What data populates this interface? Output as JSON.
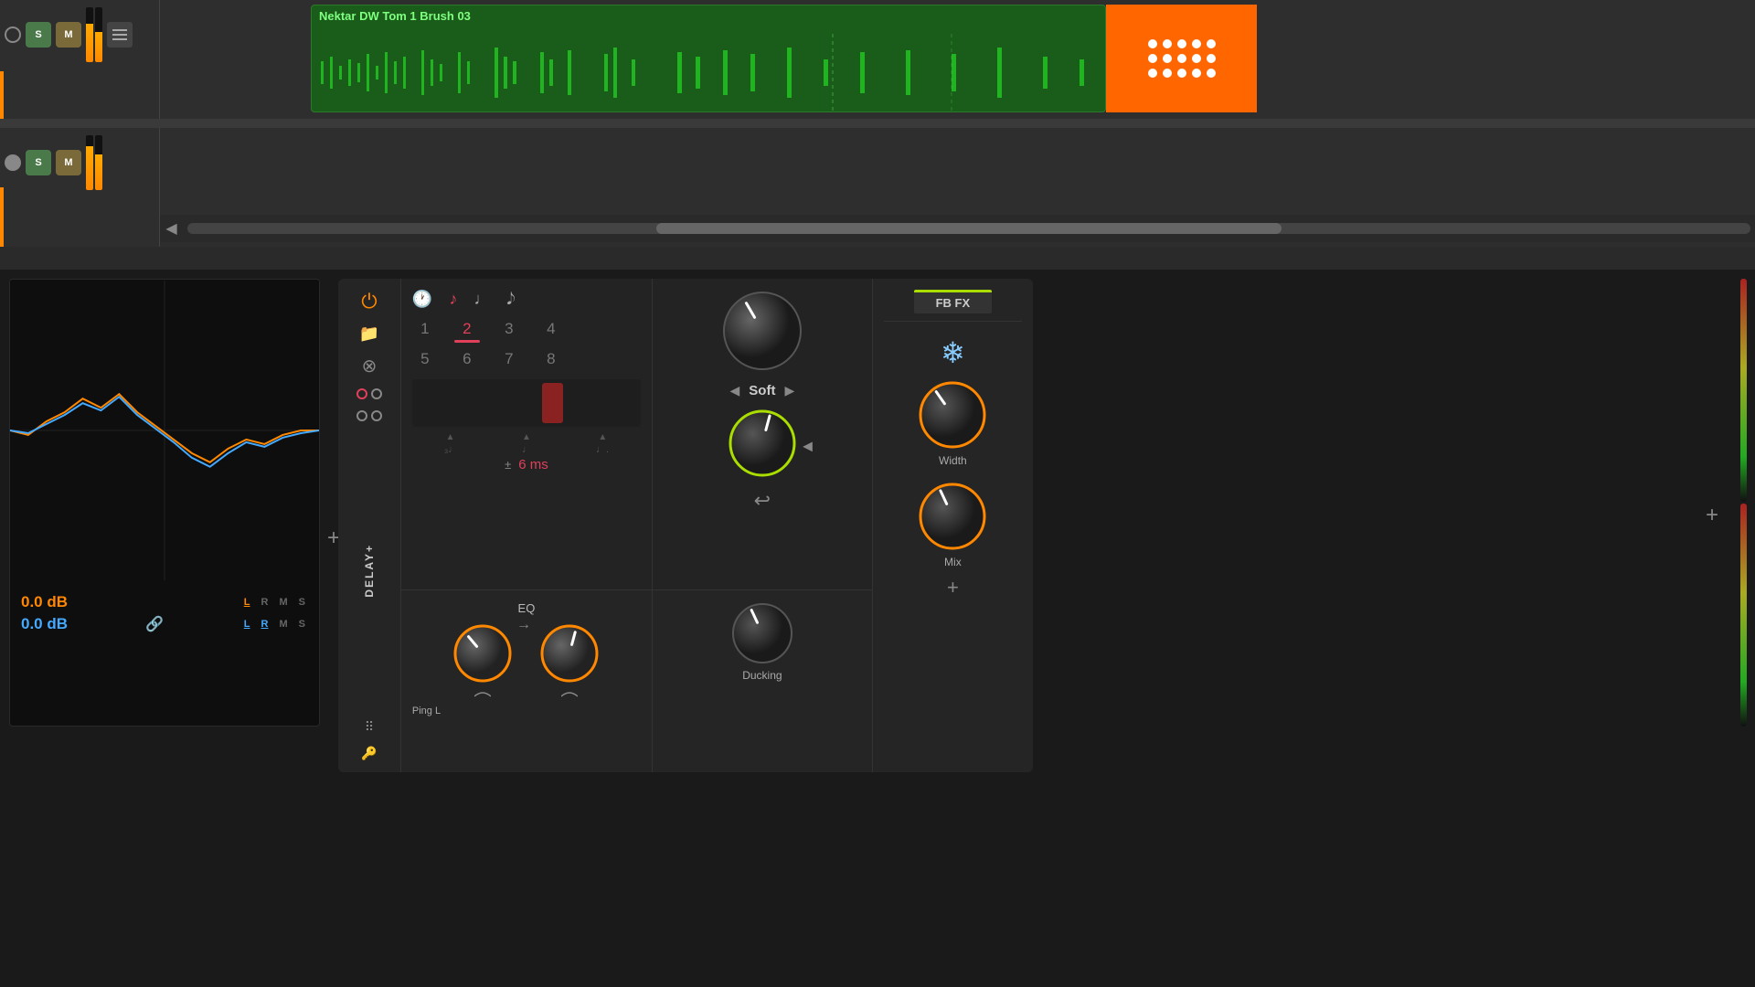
{
  "daw": {
    "track1": {
      "name": "Nektar DW Tom 1 Brush 03",
      "s_label": "S",
      "m_label": "M"
    },
    "track2": {
      "s_label": "S",
      "m_label": "M"
    }
  },
  "delay_plugin": {
    "name": "DELAY+",
    "power_on": true,
    "tabs": {
      "notes": [
        "♩",
        "♪",
        "♫",
        "𝅗𝅥"
      ],
      "active_note": "♪"
    },
    "steps": {
      "row1": [
        "1",
        "2",
        "3",
        "4"
      ],
      "row2": [
        "5",
        "6",
        "7",
        "8"
      ],
      "active": "2"
    },
    "offset": {
      "value": "6 ms",
      "prefix": "±"
    },
    "eq_label": "EQ",
    "ping_label": "Ping L",
    "soft": {
      "label": "Soft",
      "prev": "◀",
      "next": "▶"
    },
    "loop_icon": "↩"
  },
  "fbfx": {
    "title": "FB FX",
    "snowflake": "❄",
    "width_label": "Width",
    "mix_label": "Mix"
  },
  "analyzer": {
    "db_orange": "0.0 dB",
    "db_blue": "0.0 dB",
    "lrms_orange": [
      "L",
      "R",
      "M",
      "S"
    ],
    "lrms_blue": [
      "L",
      "R",
      "M",
      "S"
    ]
  },
  "ducking_label": "Ducking",
  "icons": {
    "plus": "+",
    "minus": "-",
    "arrow_left": "◀",
    "arrow_right": "▶"
  }
}
